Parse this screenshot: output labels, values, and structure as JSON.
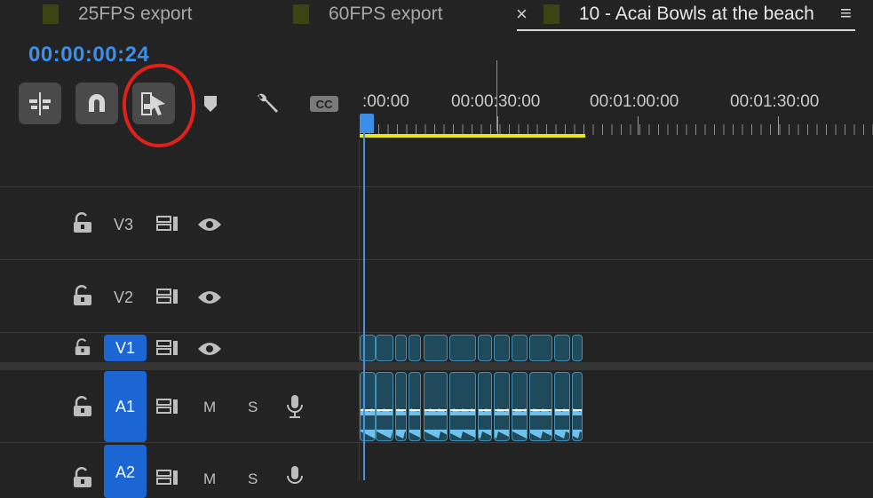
{
  "tabs": [
    {
      "label": "25FPS export",
      "swatch": "#3c4413"
    },
    {
      "label": "60FPS export",
      "swatch": "#3c4413"
    },
    {
      "label": "10 - Acai Bowls at the beach",
      "swatch": "#3c4413",
      "active": true
    }
  ],
  "timecode": "00:00:00:24",
  "ruler_labels": [
    ":00:00",
    "00:00:30:00",
    "00:01:00:00",
    "00:01:30:00"
  ],
  "tracks": {
    "v3": {
      "label": "V3"
    },
    "v2": {
      "label": "V2"
    },
    "v1": {
      "label": "V1"
    },
    "a1": {
      "label": "A1",
      "mute": "M",
      "solo": "S"
    },
    "a2": {
      "label": "A2",
      "mute": "M",
      "solo": "S"
    }
  },
  "colors": {
    "accent": "#3d8ee8",
    "work_area": "#e9e61a",
    "annotation": "#e0201a",
    "clip": "#1e4a5c",
    "track_target": "#1c66d4"
  },
  "icons": [
    "insert-overwrite-icon",
    "snap-magnet-icon",
    "linked-selection-icon",
    "add-marker-icon",
    "wrench-settings-icon",
    "captions-icon",
    "lock-icon",
    "sync-lock-icon",
    "eye-icon",
    "microphone-icon",
    "close-icon",
    "panel-menu-icon"
  ]
}
